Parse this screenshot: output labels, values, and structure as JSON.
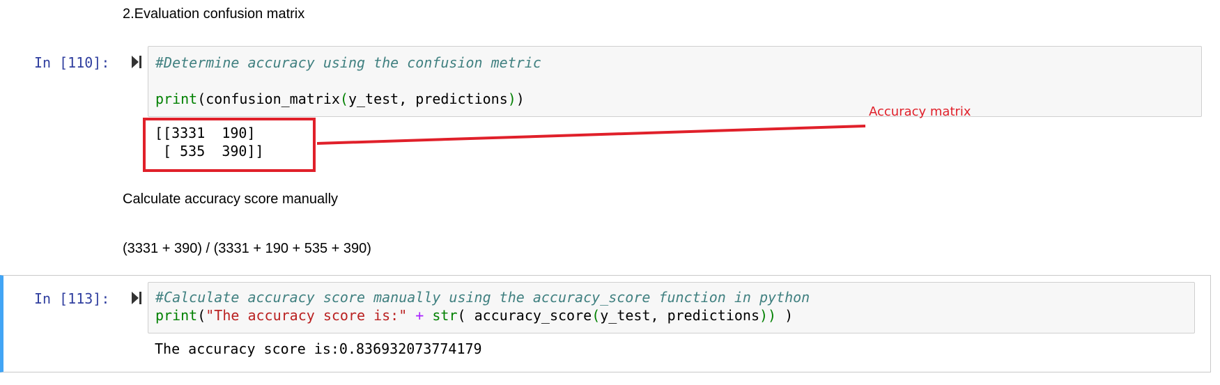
{
  "markdown": {
    "heading": "2.Evaluation confusion matrix",
    "calc_heading": "Calculate accuracy score manually",
    "formula": "(3331 + 390) / (3331 + 190 + 535 + 390)"
  },
  "cells": [
    {
      "prompt": "In [110]:",
      "comment": "#Determine accuracy using the confusion metric",
      "code": {
        "func": "print",
        "open": "(",
        "body": "confusion_matrix",
        "inner_open": "(",
        "args": "y_test, predictions",
        "inner_close": ")",
        "close": ")"
      },
      "output": "[[3331  190]\n [ 535  390]]"
    },
    {
      "prompt": "In [113]:",
      "comment": "#Calculate accuracy score manually using the accuracy_score function in python",
      "code": {
        "func": "print",
        "open": "(",
        "string": "\"The accuracy score is:\"",
        "plus": "+",
        "str_func": "str",
        "str_open": "(",
        "inner": " accuracy_score",
        "inner_open": "(",
        "args": "y_test, predictions",
        "inner_close": "))",
        "close": " )"
      },
      "output": "The accuracy score is:0.836932073774179"
    }
  ],
  "annotation": {
    "label": "Accuracy matrix",
    "color": "#e0202a"
  }
}
